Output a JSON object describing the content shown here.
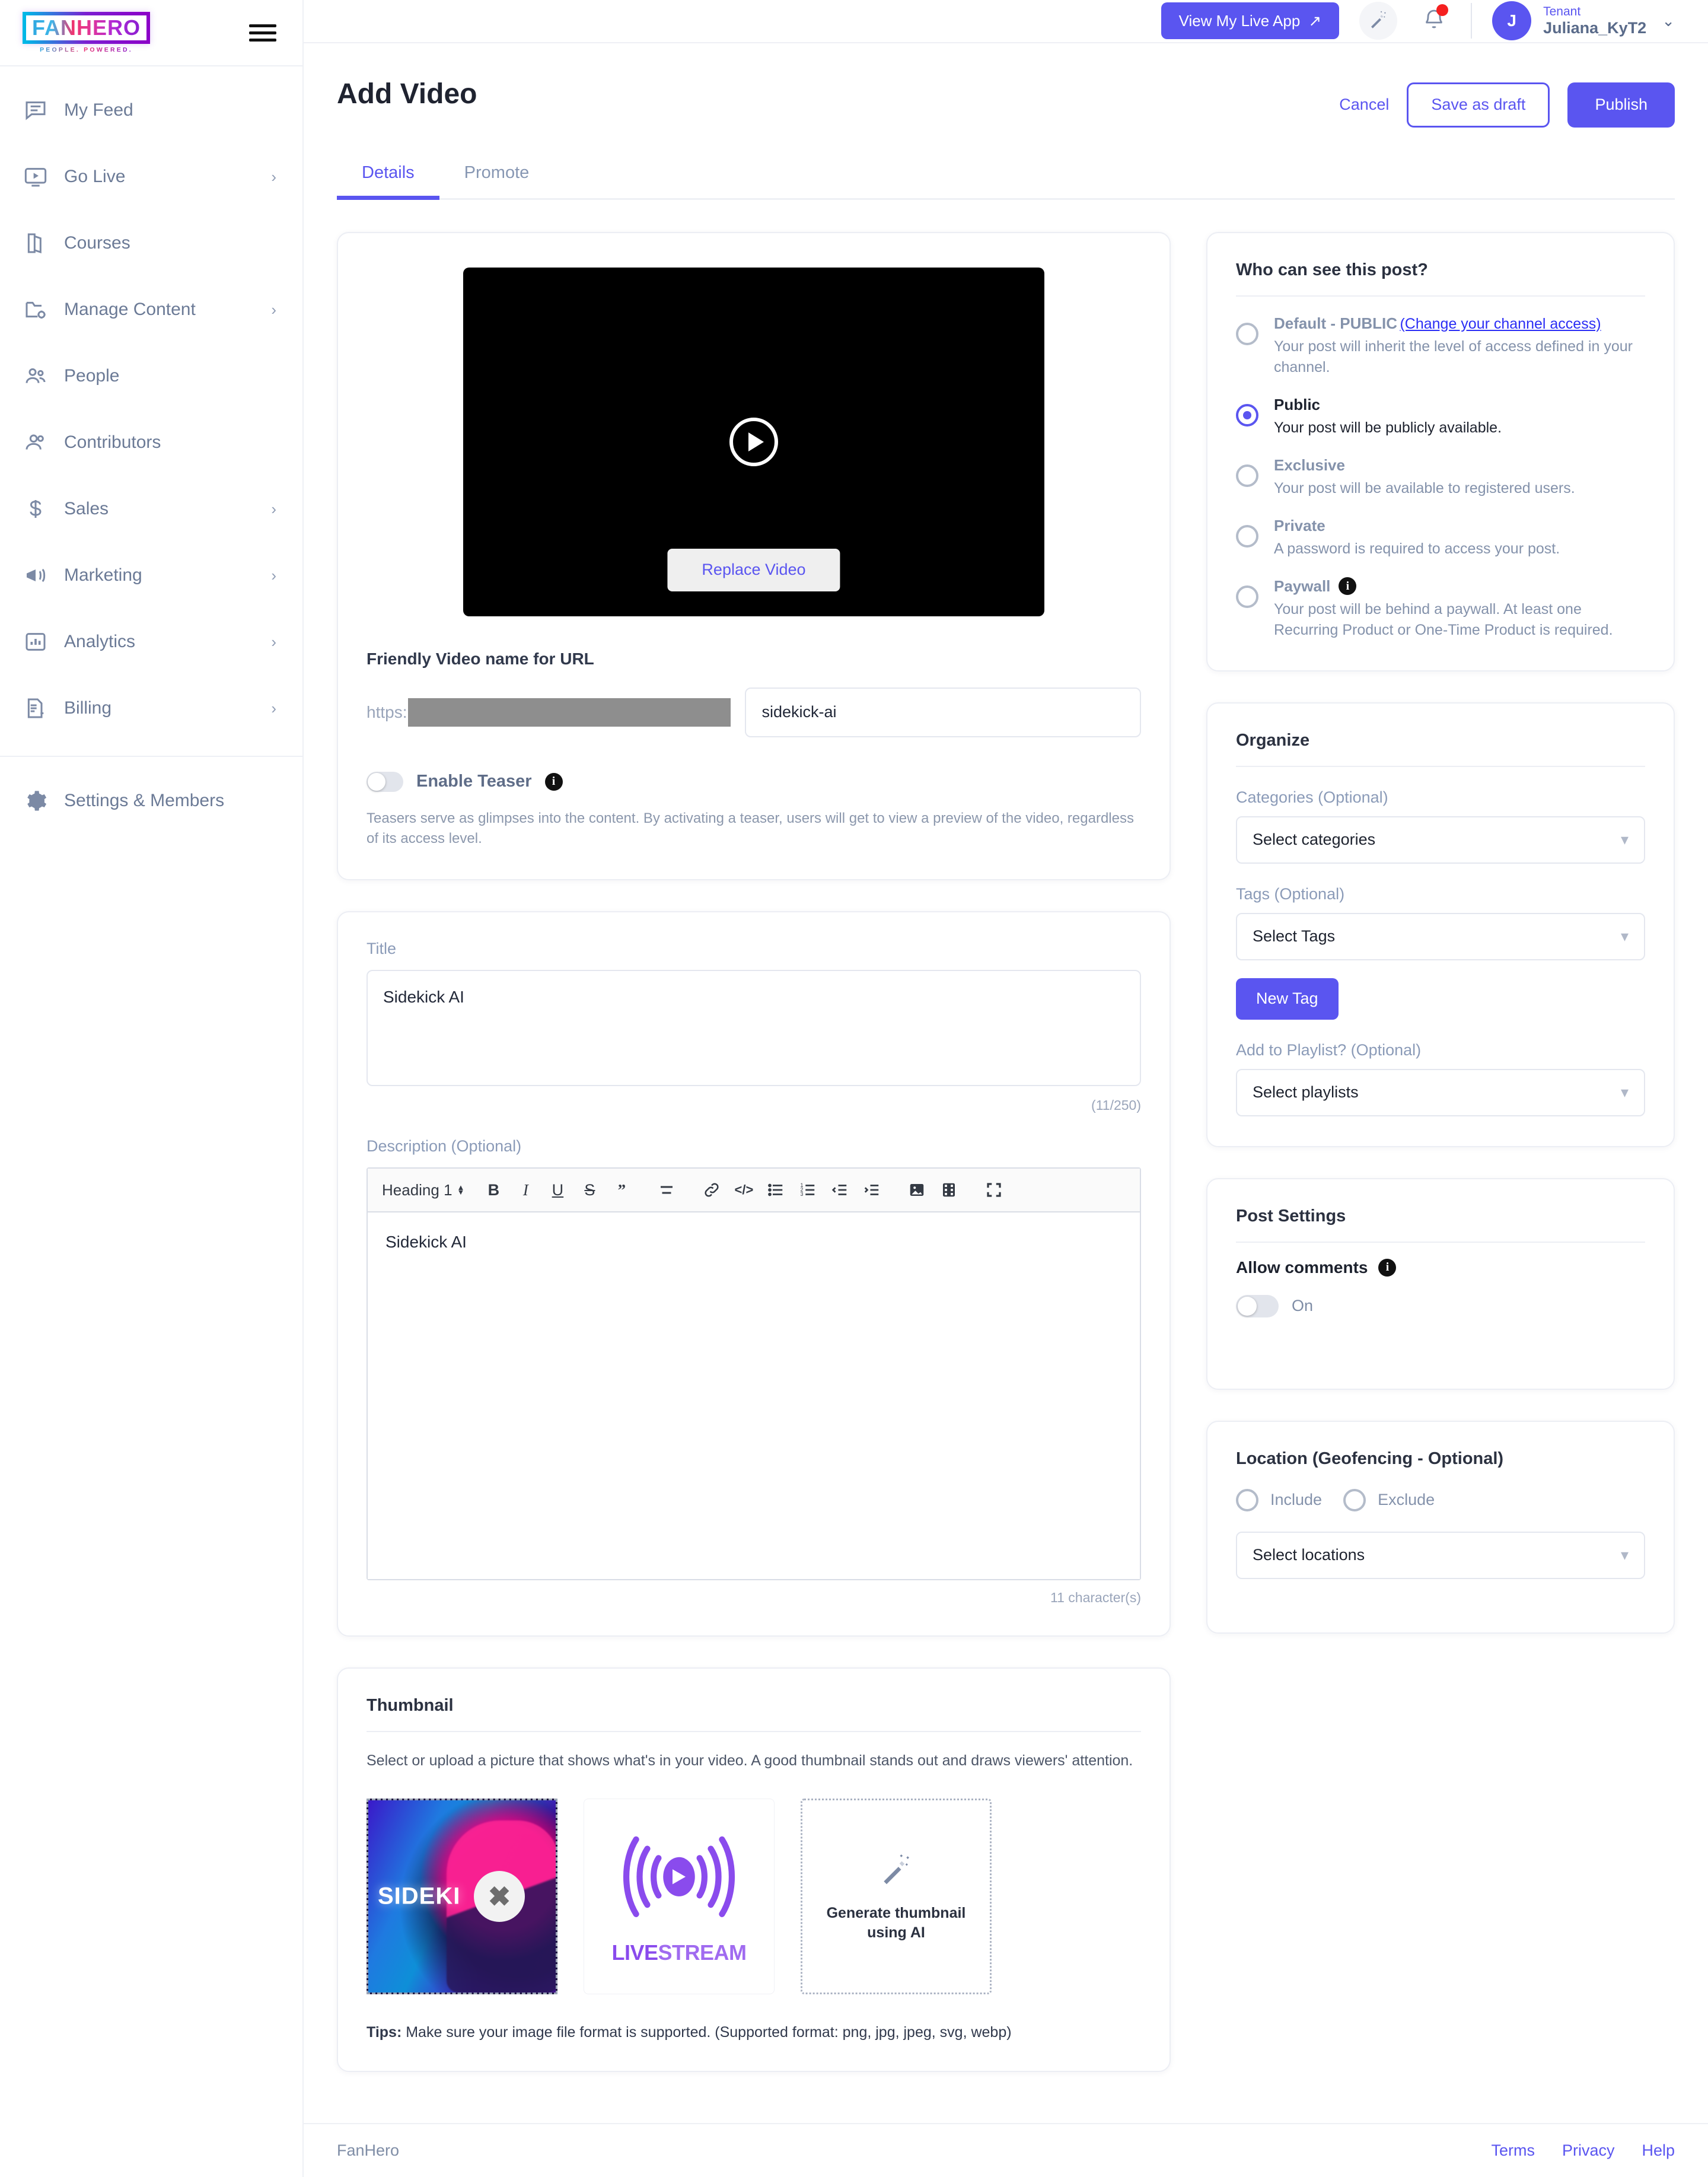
{
  "brand": {
    "logo_text": "FANHERO",
    "logo_tagline": "PEOPLE. POWERED."
  },
  "sidebar": {
    "items": [
      {
        "label": "My Feed",
        "icon": "feed-icon",
        "chevron": ""
      },
      {
        "label": "Go Live",
        "icon": "live-video-icon",
        "chevron": "›"
      },
      {
        "label": "Courses",
        "icon": "book-icon",
        "chevron": ""
      },
      {
        "label": "Manage Content",
        "icon": "folder-gear-icon",
        "chevron": "›"
      },
      {
        "label": "People",
        "icon": "people-group-icon",
        "chevron": ""
      },
      {
        "label": "Contributors",
        "icon": "contributors-icon",
        "chevron": ""
      },
      {
        "label": "Sales",
        "icon": "dollar-icon",
        "chevron": "›"
      },
      {
        "label": "Marketing",
        "icon": "megaphone-icon",
        "chevron": "›"
      },
      {
        "label": "Analytics",
        "icon": "bar-chart-icon",
        "chevron": "›"
      },
      {
        "label": "Billing",
        "icon": "invoice-icon",
        "chevron": "›"
      }
    ],
    "settings": {
      "label": "Settings & Members",
      "icon": "gear-icon"
    }
  },
  "topbar": {
    "live_app_button": "View My Live App",
    "live_app_arrow": "↗",
    "ai_icon": "magic-wand-icon",
    "bell_icon": "bell-icon",
    "avatar_initial": "J",
    "user_role": "Tenant",
    "user_name": "Juliana_KyT2",
    "caret": "⌄"
  },
  "header": {
    "title": "Add Video",
    "cancel": "Cancel",
    "save_draft": "Save as draft",
    "publish": "Publish"
  },
  "tabs": [
    {
      "label": "Details",
      "active": true
    },
    {
      "label": "Promote",
      "active": false
    }
  ],
  "video": {
    "play_icon": "play-icon",
    "replace_label": "Replace Video"
  },
  "url_section": {
    "label": "Friendly Video name for URL",
    "prefix": "https:",
    "value": "sidekick-ai",
    "placeholder": "sidekick-ai"
  },
  "teaser": {
    "label": "Enable Teaser",
    "info_icon": "info-icon",
    "state": "off",
    "helper": "Teasers serve as glimpses into the content. By activating a teaser, users will get to view a preview of the video, regardless of its access level."
  },
  "title_field": {
    "label": "Title",
    "value": "Sidekick AI",
    "counter": "(11/250)"
  },
  "description": {
    "label": "Description (Optional)",
    "heading_select": "Heading 1",
    "toolbar": [
      {
        "name": "bold-icon",
        "glyph": "B"
      },
      {
        "name": "italic-icon",
        "glyph": "I"
      },
      {
        "name": "underline-icon",
        "glyph": "U"
      },
      {
        "name": "strikethrough-icon",
        "glyph": "S"
      },
      {
        "name": "blockquote-icon",
        "glyph": "”"
      },
      {
        "name": "align-icon",
        "glyph": "≡"
      },
      {
        "name": "link-icon",
        "glyph": "🔗"
      },
      {
        "name": "code-icon",
        "glyph": "</>"
      },
      {
        "name": "bullet-list-icon",
        "glyph": "☰"
      },
      {
        "name": "numbered-list-icon",
        "glyph": "1."
      },
      {
        "name": "outdent-icon",
        "glyph": "⇤"
      },
      {
        "name": "indent-icon",
        "glyph": "⇥"
      },
      {
        "name": "image-icon",
        "glyph": "▣"
      },
      {
        "name": "video-embed-icon",
        "glyph": "▤"
      },
      {
        "name": "fullscreen-icon",
        "glyph": "⛶"
      }
    ],
    "value": "Sidekick AI",
    "char_count": "11 character(s)"
  },
  "thumbnail": {
    "title": "Thumbnail",
    "description": "Select or upload a picture that shows what's in your video. A good thumbnail stands out and draws viewers' attention.",
    "option_a_label": "SIDEKI",
    "option_a_badge": "✖",
    "option_b_live": "LIVE",
    "option_b_stream": "STREAM",
    "option_c_label": "Generate thumbnail using AI",
    "option_c_icon": "magic-wand-icon",
    "tips_prefix": "Tips:",
    "tips_text": " Make sure your image file format is supported. (Supported format: png, jpg, jpeg, svg, webp)"
  },
  "visibility": {
    "title": "Who can see this post?",
    "options": [
      {
        "name": "Default - PUBLIC",
        "link": "(Change your channel access)",
        "desc": "Your post will inherit the level of access defined in your channel.",
        "selected": false,
        "info": false
      },
      {
        "name": "Public",
        "link": "",
        "desc": "Your post will be publicly available.",
        "selected": true,
        "info": false
      },
      {
        "name": "Exclusive",
        "link": "",
        "desc": "Your post will be available to registered users.",
        "selected": false,
        "info": false
      },
      {
        "name": "Private",
        "link": "",
        "desc": "A password is required to access your post.",
        "selected": false,
        "info": false
      },
      {
        "name": "Paywall",
        "link": "",
        "desc": "Your post will be behind a paywall. At least one Recurring Product or One-Time Product is required.",
        "selected": false,
        "info": true
      }
    ]
  },
  "organize": {
    "title": "Organize",
    "categories_label": "Categories (Optional)",
    "categories_value": "Select categories",
    "tags_label": "Tags (Optional)",
    "tags_value": "Select Tags",
    "new_tag_button": "New Tag",
    "playlist_label": "Add to Playlist? (Optional)",
    "playlist_value": "Select playlists"
  },
  "post_settings": {
    "title": "Post Settings",
    "allow_comments_label": "Allow comments",
    "info_icon": "info-icon",
    "toggle_state": "On"
  },
  "location": {
    "title": "Location (Geofencing - Optional)",
    "include_label": "Include",
    "exclude_label": "Exclude",
    "select_value": "Select locations"
  },
  "footer": {
    "brand": "FanHero",
    "links": [
      "Terms",
      "Privacy",
      "Help"
    ]
  },
  "colors": {
    "accent": "#5a55f0",
    "muted": "#8492ab",
    "link": "#2b2ef5",
    "purple_logo": "#8a4bed",
    "alert": "#f52020"
  }
}
